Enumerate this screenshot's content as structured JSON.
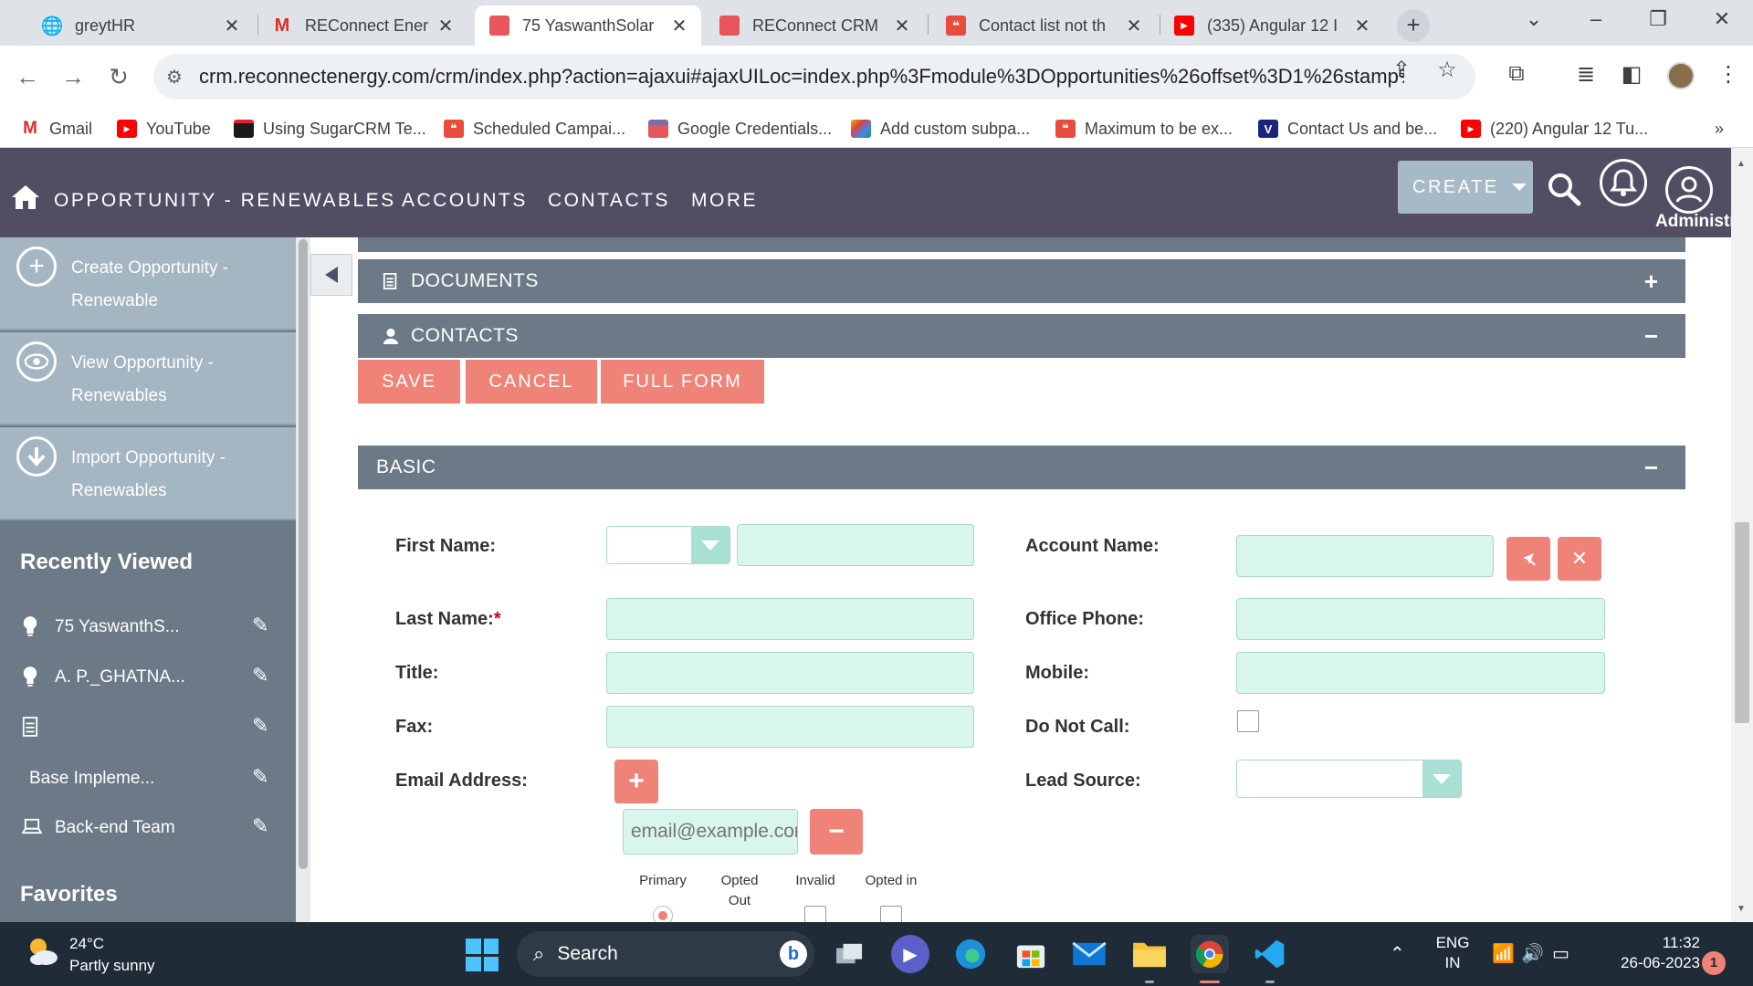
{
  "browser": {
    "tabs": [
      {
        "title": "greytHR",
        "favicon": "globe-icon"
      },
      {
        "title": "REConnect Energy",
        "favicon": "gmail-icon"
      },
      {
        "title": "75 YaswanthSolar",
        "favicon": "suitecrm-icon",
        "active": true
      },
      {
        "title": "REConnect CRM",
        "favicon": "suitecrm-icon"
      },
      {
        "title": "Contact list not th",
        "favicon": "sugar-icon"
      },
      {
        "title": "(335) Angular 12 I",
        "favicon": "youtube-icon"
      }
    ],
    "url": "crm.reconnectenergy.com/crm/index.php?action=ajaxui#ajaxUILoc=index.php%3Fmodule%3DOpportunities%26offset%3D1%26stamp%3...",
    "bookmarks": [
      {
        "label": "Gmail",
        "icon": "gmail-icon"
      },
      {
        "label": "YouTube",
        "icon": "youtube-icon"
      },
      {
        "label": "Using SugarCRM Te...",
        "icon": "sugar-icon"
      },
      {
        "label": "Scheduled Campai...",
        "icon": "sugar-icon"
      },
      {
        "label": "Google Credentials...",
        "icon": "suitecrm-icon"
      },
      {
        "label": "Add custom subpa...",
        "icon": "colorful-icon"
      },
      {
        "label": "Maximum to be ex...",
        "icon": "sugar-icon"
      },
      {
        "label": "Contact Us and be...",
        "icon": "v-icon"
      },
      {
        "label": "(220) Angular 12 Tu...",
        "icon": "youtube-icon"
      }
    ],
    "bookmarks_more": "»"
  },
  "nav": {
    "items": [
      "OPPORTUNITY - RENEWABLES",
      "ACCOUNTS",
      "CONTACTS",
      "MORE"
    ],
    "create_label": "CREATE",
    "admin_label": "Administr"
  },
  "sidebar": {
    "actions": [
      {
        "label": "Create Opportunity - Renewable",
        "icon": "plus-circle-icon"
      },
      {
        "label": "View Opportunity - Renewables",
        "icon": "eye-icon"
      },
      {
        "label": "Import Opportunity - Renewables",
        "icon": "download-icon"
      }
    ],
    "recently_viewed_title": "Recently Viewed",
    "recent": [
      {
        "label": "75 YaswanthS...",
        "icon": "lightbulb-icon"
      },
      {
        "label": "A. P._GHATNA...",
        "icon": "lightbulb-icon"
      },
      {
        "label": "",
        "icon": "document-icon"
      },
      {
        "label": "Base Impleme...",
        "icon": ""
      },
      {
        "label": "Back-end Team",
        "icon": "laptop-icon"
      }
    ],
    "favorites_title": "Favorites"
  },
  "panels": {
    "documents": {
      "title": "DOCUMENTS",
      "toggle": "+"
    },
    "contacts": {
      "title": "CONTACTS",
      "toggle": "−"
    },
    "basic": {
      "title": "BASIC",
      "toggle": "−"
    }
  },
  "buttons": {
    "save": "SAVE",
    "cancel": "CANCEL",
    "full_form": "FULL FORM"
  },
  "form": {
    "first_name_label": "First Name:",
    "last_name_label": "Last Name:",
    "required_mark": "*",
    "title_label": "Title:",
    "fax_label": "Fax:",
    "email_label": "Email Address:",
    "account_name_label": "Account Name:",
    "office_phone_label": "Office Phone:",
    "mobile_label": "Mobile:",
    "do_not_call_label": "Do Not Call:",
    "lead_source_label": "Lead Source:",
    "email_placeholder": "email@example.com",
    "email_options": {
      "primary": "Primary",
      "opted_out": "Opted Out",
      "invalid": "Invalid",
      "opted_in": "Opted in"
    }
  },
  "taskbar": {
    "temperature": "24°C",
    "weather": "Partly sunny",
    "search_label": "Search",
    "lang_top": "ENG",
    "lang_bottom": "IN",
    "time": "11:32",
    "date": "26-06-2023",
    "notification_count": "1"
  },
  "colors": {
    "nav_bg": "#534d64",
    "panel_bg": "#6c7a87",
    "accent_button": "#f08377",
    "input_bg": "#d8f5ee",
    "sidebar_action_bg": "#a4b6c2"
  }
}
